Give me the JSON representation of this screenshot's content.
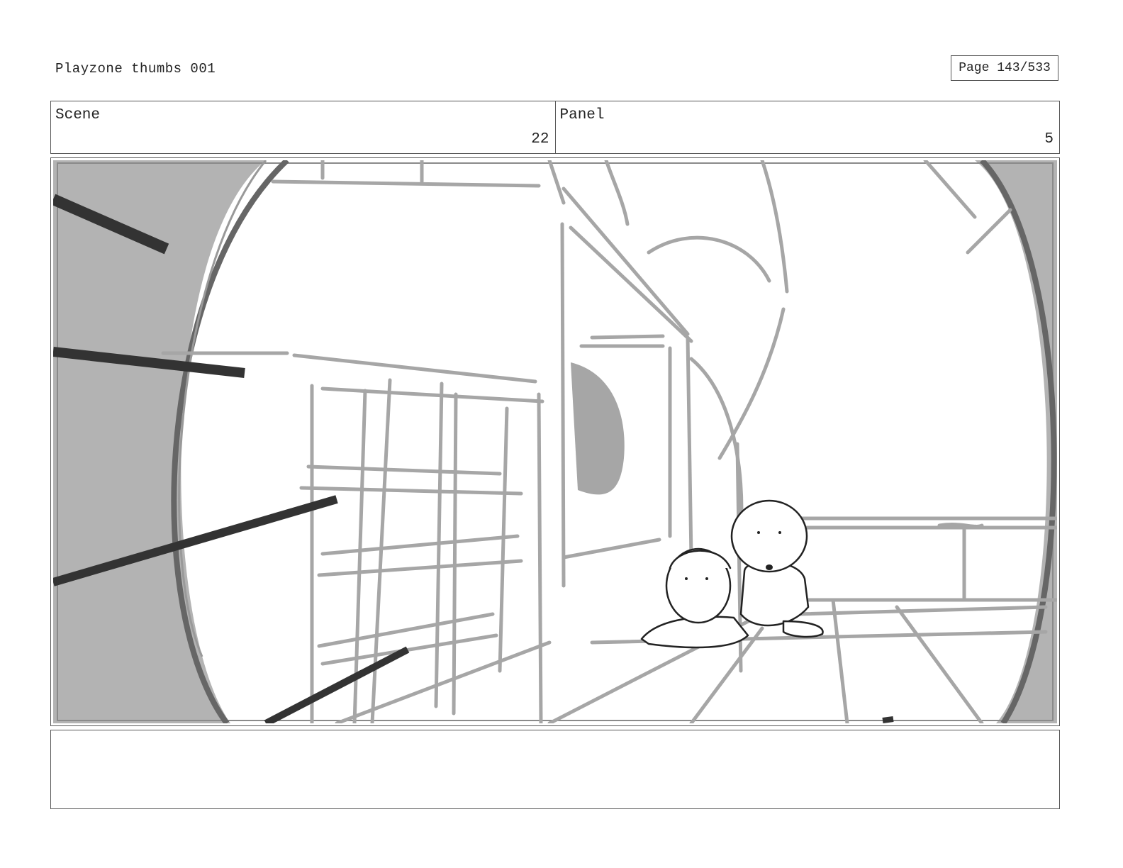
{
  "header": {
    "document_title": "Playzone thumbs 001",
    "page_label": "Page 143/533"
  },
  "panel_info": {
    "scene_label": "Scene",
    "scene_number": "22",
    "panel_label": "Panel",
    "panel_number": "5"
  },
  "notes": {
    "text": ""
  },
  "colors": {
    "sketch_gray": "#a6a6a6",
    "vignette_gray": "#b3b3b3",
    "dark_stroke": "#333333",
    "border": "#555555"
  }
}
